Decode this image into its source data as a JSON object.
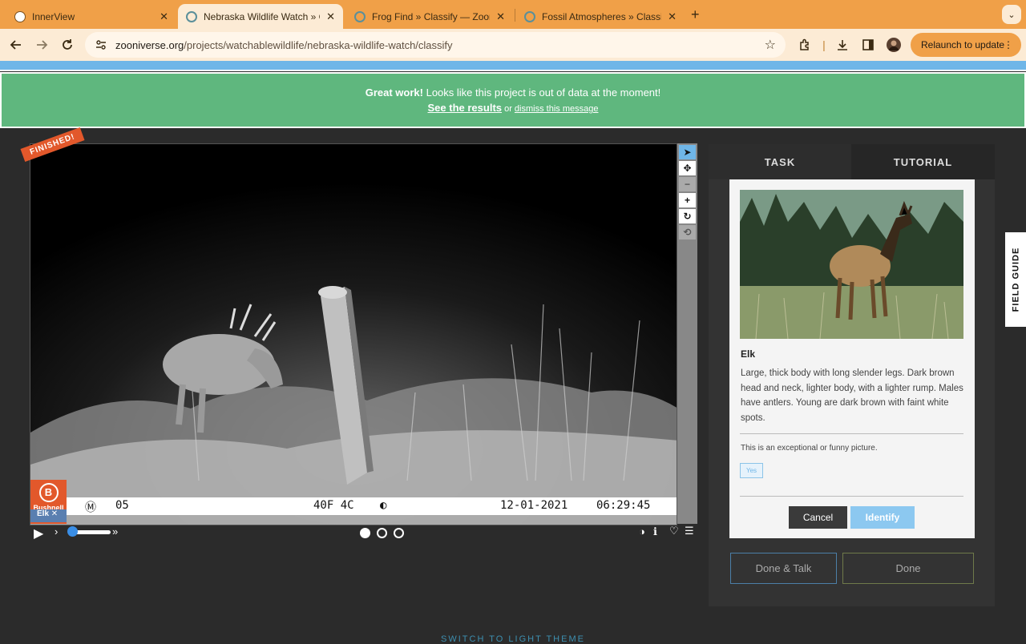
{
  "browser": {
    "tabs": [
      {
        "title": "InnerView",
        "close": "✕"
      },
      {
        "title": "Nebraska Wildlife Watch » Classify",
        "close": "✕"
      },
      {
        "title": "Frog Find » Classify — Zooniverse",
        "close": "✕"
      },
      {
        "title": "Fossil Atmospheres » Classify",
        "close": "✕"
      }
    ],
    "new_tab": "+",
    "tab_menu": "⌄",
    "url_host": "zooniverse.org",
    "url_path": "/projects/watchablewildlife/nebraska-wildlife-watch/classify",
    "relaunch_label": "Relaunch to update",
    "relaunch_menu": "⋮"
  },
  "banner": {
    "strong": "Great work!",
    "message": " Looks like this project is out of data at the moment!",
    "see_results": "See the results",
    "or": " or ",
    "dismiss": "dismiss this message"
  },
  "viewer": {
    "ribbon": "FINISHED!",
    "tools": [
      "pointer",
      "move",
      "zoom-out",
      "zoom-in",
      "rotate",
      "reset"
    ],
    "camera_info": {
      "mode_icon": "Ⓜ",
      "frame": "05",
      "temperature": "40F 4C",
      "date": "12-01-2021",
      "time": "06:29:45"
    },
    "brand": "Bushnell",
    "brand_logo": "B",
    "species_tag": "Elk",
    "species_tag_mark": "✕",
    "frames": 3,
    "current_frame": 1,
    "playback_speed": 0.2
  },
  "panel": {
    "tab_task": "TASK",
    "tab_tutorial": "TUTORIAL",
    "species_name": "Elk",
    "species_description": "Large, thick body with long slender legs. Dark brown head and neck, lighter body, with a lighter rump. Males have antlers. Young are dark brown with faint white spots.",
    "question": "This is an exceptional or funny picture.",
    "yes_label": "Yes",
    "cancel_label": "Cancel",
    "identify_label": "Identify",
    "done_talk_label": "Done & Talk",
    "done_label": "Done"
  },
  "field_guide_label": "FIELD GUIDE",
  "switch_theme_label": "SWITCH TO LIGHT THEME"
}
